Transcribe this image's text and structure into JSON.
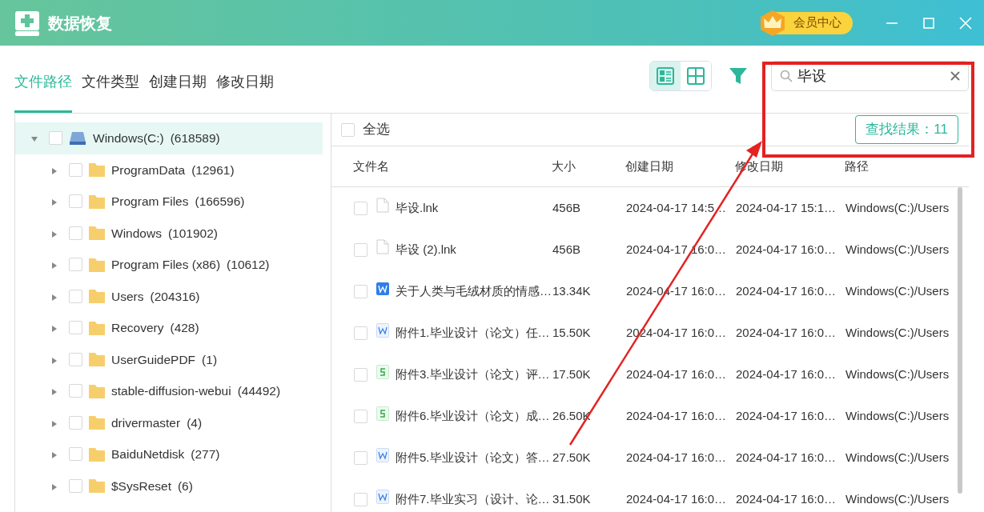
{
  "window": {
    "title": "数据恢复",
    "vip_button": "会员中心"
  },
  "tabs": [
    {
      "label": "文件路径",
      "selected": true
    },
    {
      "label": "文件类型",
      "selected": false
    },
    {
      "label": "创建日期",
      "selected": false
    },
    {
      "label": "修改日期",
      "selected": false
    }
  ],
  "view_toggle": [
    {
      "kind": "list",
      "selected": true
    },
    {
      "kind": "grid",
      "selected": false
    }
  ],
  "search": {
    "value": "毕设",
    "result_badge": "查找结果：11"
  },
  "tree": [
    {
      "kind": "drive",
      "label": "Windows(C:)",
      "count": "(618589)",
      "checked": false,
      "expanded": true,
      "selected": true,
      "children": [
        {
          "kind": "folder",
          "label": "ProgramData",
          "count": "(12961)",
          "checked": false,
          "expanded": false,
          "selected": false
        },
        {
          "kind": "folder",
          "label": "Program Files",
          "count": "(166596)",
          "checked": false,
          "expanded": false,
          "selected": false
        },
        {
          "kind": "folder",
          "label": "Windows",
          "count": "(101902)",
          "checked": false,
          "expanded": false,
          "selected": false
        },
        {
          "kind": "folder",
          "label": "Program Files (x86)",
          "count": "(10612)",
          "checked": false,
          "expanded": false,
          "selected": false
        },
        {
          "kind": "folder",
          "label": "Users",
          "count": "(204316)",
          "checked": false,
          "expanded": false,
          "selected": false
        },
        {
          "kind": "folder",
          "label": "Recovery",
          "count": "(428)",
          "checked": false,
          "expanded": false,
          "selected": false
        },
        {
          "kind": "folder",
          "label": "UserGuidePDF",
          "count": "(1)",
          "checked": false,
          "expanded": false,
          "selected": false
        },
        {
          "kind": "folder",
          "label": "stable-diffusion-webui",
          "count": "(44492)",
          "checked": false,
          "expanded": false,
          "selected": false
        },
        {
          "kind": "folder",
          "label": "drivermaster",
          "count": "(4)",
          "checked": false,
          "expanded": false,
          "selected": false
        },
        {
          "kind": "folder",
          "label": "BaiduNetdisk",
          "count": "(277)",
          "checked": false,
          "expanded": false,
          "selected": false
        },
        {
          "kind": "folder",
          "label": "$SysReset",
          "count": "(6)",
          "checked": false,
          "expanded": false,
          "selected": false
        }
      ]
    }
  ],
  "select_all": {
    "label": "全选",
    "checked": false
  },
  "table": {
    "columns": [
      "文件名",
      "大小",
      "创建日期",
      "修改日期",
      "路径"
    ],
    "rows": [
      {
        "kind": "blank",
        "name": "毕设.lnk",
        "size": "456B",
        "created": "2024-04-17 14:5…",
        "modified": "2024-04-17 15:1…",
        "path": "Windows(C:)/Users",
        "checked": false
      },
      {
        "kind": "blank",
        "name": "毕设 (2).lnk",
        "size": "456B",
        "created": "2024-04-17 16:0…",
        "modified": "2024-04-17 16:0…",
        "path": "Windows(C:)/Users",
        "checked": false
      },
      {
        "kind": "doc-filled",
        "name": "关于人类与毛绒材质的情感…",
        "size": "13.34K",
        "created": "2024-04-17 16:0…",
        "modified": "2024-04-17 16:0…",
        "path": "Windows(C:)/Users",
        "checked": false
      },
      {
        "kind": "doc",
        "name": "附件1.毕业设计（论文）任…",
        "size": "15.50K",
        "created": "2024-04-17 16:0…",
        "modified": "2024-04-17 16:0…",
        "path": "Windows(C:)/Users",
        "checked": false
      },
      {
        "kind": "sheet",
        "name": "附件3.毕业设计（论文）评…",
        "size": "17.50K",
        "created": "2024-04-17 16:0…",
        "modified": "2024-04-17 16:0…",
        "path": "Windows(C:)/Users",
        "checked": false
      },
      {
        "kind": "sheet",
        "name": "附件6.毕业设计（论文）成…",
        "size": "26.50K",
        "created": "2024-04-17 16:0…",
        "modified": "2024-04-17 16:0…",
        "path": "Windows(C:)/Users",
        "checked": false
      },
      {
        "kind": "doc",
        "name": "附件5.毕业设计（论文）答…",
        "size": "27.50K",
        "created": "2024-04-17 16:0…",
        "modified": "2024-04-17 16:0…",
        "path": "Windows(C:)/Users",
        "checked": false
      },
      {
        "kind": "doc",
        "name": "附件7.毕业实习（设计、论…",
        "size": "31.50K",
        "created": "2024-04-17 16:0…",
        "modified": "2024-04-17 16:0…",
        "path": "Windows(C:)/Users",
        "checked": false
      }
    ]
  }
}
